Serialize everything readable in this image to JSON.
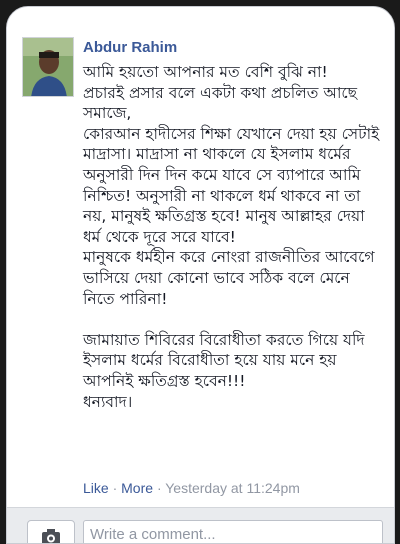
{
  "post": {
    "author": "Abdur Rahim",
    "body": "আমি হয়তো আপনার মত বেশি বুঝি না!\nপ্রচারই প্রসার বলে একটা কথা প্রচলিত আছে সমাজে,\nকোরআন হাদীসের শিক্ষা যেখানে দেয়া হয় সেটাই মাদ্রাসা। মাদ্রাসা না থাকলে যে ইসলাম ধর্মের অনুসারী দিন দিন কমে যাবে সে ব্যাপারে আমি নিশ্চিত! অনুসারী না থাকলে ধর্ম থাকবে না তা নয়, মানুষই ক্ষতিগ্রস্ত হবে! মানুষ আল্লাহর দেয়া ধর্ম থেকে দূরে সরে যাবে!\nমানুষকে ধর্মহীন করে নোংরা রাজনীতির আবেগে ভাসিয়ে দেয়া কোনো ভাবে সঠিক বলে মেনে নিতে পারিনা!\n\nজামায়াত শিবিরের বিরোধীতা করতে গিয়ে যদি ইসলাম ধর্মের বিরোধীতা হয়ে যায় মনে হয় আপনিই ক্ষতিগ্রস্ত হবেন!!!\nধন্যবাদ।",
    "like_label": "Like",
    "more_label": "More",
    "separator": "·",
    "timestamp": "Yesterday at 11:24pm"
  },
  "comment_box": {
    "placeholder": "Write a comment...",
    "camera_icon": "camera-icon"
  },
  "colors": {
    "link": "#3b5998",
    "meta": "#9197a3",
    "text": "#141823"
  }
}
